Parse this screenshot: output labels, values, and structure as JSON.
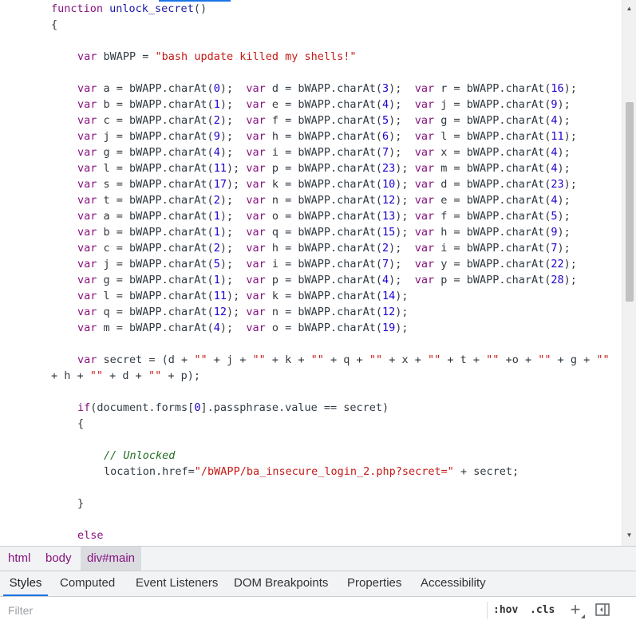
{
  "code_lines": [
    [
      [
        "kw",
        "function "
      ],
      [
        "fn",
        "unlock_secret"
      ],
      [
        "op",
        "()"
      ]
    ],
    [
      [
        "op",
        "{"
      ]
    ],
    [],
    [
      [
        "kw",
        "var "
      ],
      [
        "op",
        "bWAPP = "
      ],
      [
        "str",
        "\"bash update killed my shells!\""
      ]
    ],
    [],
    [
      [
        "kw",
        "var "
      ],
      [
        "op",
        "a = bWAPP.charAt("
      ],
      [
        "num",
        "0"
      ],
      [
        "op",
        ");  "
      ],
      [
        "kw",
        "var "
      ],
      [
        "op",
        "d = bWAPP.charAt("
      ],
      [
        "num",
        "3"
      ],
      [
        "op",
        ");  "
      ],
      [
        "kw",
        "var "
      ],
      [
        "op",
        "r = bWAPP.charAt("
      ],
      [
        "num",
        "16"
      ],
      [
        "op",
        ");"
      ]
    ],
    [
      [
        "kw",
        "var "
      ],
      [
        "op",
        "b = bWAPP.charAt("
      ],
      [
        "num",
        "1"
      ],
      [
        "op",
        ");  "
      ],
      [
        "kw",
        "var "
      ],
      [
        "op",
        "e = bWAPP.charAt("
      ],
      [
        "num",
        "4"
      ],
      [
        "op",
        ");  "
      ],
      [
        "kw",
        "var "
      ],
      [
        "op",
        "j = bWAPP.charAt("
      ],
      [
        "num",
        "9"
      ],
      [
        "op",
        ");"
      ]
    ],
    [
      [
        "kw",
        "var "
      ],
      [
        "op",
        "c = bWAPP.charAt("
      ],
      [
        "num",
        "2"
      ],
      [
        "op",
        ");  "
      ],
      [
        "kw",
        "var "
      ],
      [
        "op",
        "f = bWAPP.charAt("
      ],
      [
        "num",
        "5"
      ],
      [
        "op",
        ");  "
      ],
      [
        "kw",
        "var "
      ],
      [
        "op",
        "g = bWAPP.charAt("
      ],
      [
        "num",
        "4"
      ],
      [
        "op",
        ");"
      ]
    ],
    [
      [
        "kw",
        "var "
      ],
      [
        "op",
        "j = bWAPP.charAt("
      ],
      [
        "num",
        "9"
      ],
      [
        "op",
        ");  "
      ],
      [
        "kw",
        "var "
      ],
      [
        "op",
        "h = bWAPP.charAt("
      ],
      [
        "num",
        "6"
      ],
      [
        "op",
        ");  "
      ],
      [
        "kw",
        "var "
      ],
      [
        "op",
        "l = bWAPP.charAt("
      ],
      [
        "num",
        "11"
      ],
      [
        "op",
        ");"
      ]
    ],
    [
      [
        "kw",
        "var "
      ],
      [
        "op",
        "g = bWAPP.charAt("
      ],
      [
        "num",
        "4"
      ],
      [
        "op",
        ");  "
      ],
      [
        "kw",
        "var "
      ],
      [
        "op",
        "i = bWAPP.charAt("
      ],
      [
        "num",
        "7"
      ],
      [
        "op",
        ");  "
      ],
      [
        "kw",
        "var "
      ],
      [
        "op",
        "x = bWAPP.charAt("
      ],
      [
        "num",
        "4"
      ],
      [
        "op",
        ");"
      ]
    ],
    [
      [
        "kw",
        "var "
      ],
      [
        "op",
        "l = bWAPP.charAt("
      ],
      [
        "num",
        "11"
      ],
      [
        "op",
        "); "
      ],
      [
        "kw",
        "var "
      ],
      [
        "op",
        "p = bWAPP.charAt("
      ],
      [
        "num",
        "23"
      ],
      [
        "op",
        "); "
      ],
      [
        "kw",
        "var "
      ],
      [
        "op",
        "m = bWAPP.charAt("
      ],
      [
        "num",
        "4"
      ],
      [
        "op",
        ");"
      ]
    ],
    [
      [
        "kw",
        "var "
      ],
      [
        "op",
        "s = bWAPP.charAt("
      ],
      [
        "num",
        "17"
      ],
      [
        "op",
        "); "
      ],
      [
        "kw",
        "var "
      ],
      [
        "op",
        "k = bWAPP.charAt("
      ],
      [
        "num",
        "10"
      ],
      [
        "op",
        "); "
      ],
      [
        "kw",
        "var "
      ],
      [
        "op",
        "d = bWAPP.charAt("
      ],
      [
        "num",
        "23"
      ],
      [
        "op",
        ");"
      ]
    ],
    [
      [
        "kw",
        "var "
      ],
      [
        "op",
        "t = bWAPP.charAt("
      ],
      [
        "num",
        "2"
      ],
      [
        "op",
        ");  "
      ],
      [
        "kw",
        "var "
      ],
      [
        "op",
        "n = bWAPP.charAt("
      ],
      [
        "num",
        "12"
      ],
      [
        "op",
        "); "
      ],
      [
        "kw",
        "var "
      ],
      [
        "op",
        "e = bWAPP.charAt("
      ],
      [
        "num",
        "4"
      ],
      [
        "op",
        ");"
      ]
    ],
    [
      [
        "kw",
        "var "
      ],
      [
        "op",
        "a = bWAPP.charAt("
      ],
      [
        "num",
        "1"
      ],
      [
        "op",
        ");  "
      ],
      [
        "kw",
        "var "
      ],
      [
        "op",
        "o = bWAPP.charAt("
      ],
      [
        "num",
        "13"
      ],
      [
        "op",
        "); "
      ],
      [
        "kw",
        "var "
      ],
      [
        "op",
        "f = bWAPP.charAt("
      ],
      [
        "num",
        "5"
      ],
      [
        "op",
        ");"
      ]
    ],
    [
      [
        "kw",
        "var "
      ],
      [
        "op",
        "b = bWAPP.charAt("
      ],
      [
        "num",
        "1"
      ],
      [
        "op",
        ");  "
      ],
      [
        "kw",
        "var "
      ],
      [
        "op",
        "q = bWAPP.charAt("
      ],
      [
        "num",
        "15"
      ],
      [
        "op",
        "); "
      ],
      [
        "kw",
        "var "
      ],
      [
        "op",
        "h = bWAPP.charAt("
      ],
      [
        "num",
        "9"
      ],
      [
        "op",
        ");"
      ]
    ],
    [
      [
        "kw",
        "var "
      ],
      [
        "op",
        "c = bWAPP.charAt("
      ],
      [
        "num",
        "2"
      ],
      [
        "op",
        ");  "
      ],
      [
        "kw",
        "var "
      ],
      [
        "op",
        "h = bWAPP.charAt("
      ],
      [
        "num",
        "2"
      ],
      [
        "op",
        ");  "
      ],
      [
        "kw",
        "var "
      ],
      [
        "op",
        "i = bWAPP.charAt("
      ],
      [
        "num",
        "7"
      ],
      [
        "op",
        ");"
      ]
    ],
    [
      [
        "kw",
        "var "
      ],
      [
        "op",
        "j = bWAPP.charAt("
      ],
      [
        "num",
        "5"
      ],
      [
        "op",
        ");  "
      ],
      [
        "kw",
        "var "
      ],
      [
        "op",
        "i = bWAPP.charAt("
      ],
      [
        "num",
        "7"
      ],
      [
        "op",
        ");  "
      ],
      [
        "kw",
        "var "
      ],
      [
        "op",
        "y = bWAPP.charAt("
      ],
      [
        "num",
        "22"
      ],
      [
        "op",
        ");"
      ]
    ],
    [
      [
        "kw",
        "var "
      ],
      [
        "op",
        "g = bWAPP.charAt("
      ],
      [
        "num",
        "1"
      ],
      [
        "op",
        ");  "
      ],
      [
        "kw",
        "var "
      ],
      [
        "op",
        "p = bWAPP.charAt("
      ],
      [
        "num",
        "4"
      ],
      [
        "op",
        ");  "
      ],
      [
        "kw",
        "var "
      ],
      [
        "op",
        "p = bWAPP.charAt("
      ],
      [
        "num",
        "28"
      ],
      [
        "op",
        ");"
      ]
    ],
    [
      [
        "kw",
        "var "
      ],
      [
        "op",
        "l = bWAPP.charAt("
      ],
      [
        "num",
        "11"
      ],
      [
        "op",
        "); "
      ],
      [
        "kw",
        "var "
      ],
      [
        "op",
        "k = bWAPP.charAt("
      ],
      [
        "num",
        "14"
      ],
      [
        "op",
        ");"
      ]
    ],
    [
      [
        "kw",
        "var "
      ],
      [
        "op",
        "q = bWAPP.charAt("
      ],
      [
        "num",
        "12"
      ],
      [
        "op",
        "); "
      ],
      [
        "kw",
        "var "
      ],
      [
        "op",
        "n = bWAPP.charAt("
      ],
      [
        "num",
        "12"
      ],
      [
        "op",
        ");"
      ]
    ],
    [
      [
        "kw",
        "var "
      ],
      [
        "op",
        "m = bWAPP.charAt("
      ],
      [
        "num",
        "4"
      ],
      [
        "op",
        ");  "
      ],
      [
        "kw",
        "var "
      ],
      [
        "op",
        "o = bWAPP.charAt("
      ],
      [
        "num",
        "19"
      ],
      [
        "op",
        ");"
      ]
    ],
    [],
    [
      [
        "kw",
        "var "
      ],
      [
        "op",
        "secret = (d + "
      ],
      [
        "str",
        "\"\""
      ],
      [
        "op",
        " + j + "
      ],
      [
        "str",
        "\"\""
      ],
      [
        "op",
        " + k + "
      ],
      [
        "str",
        "\"\""
      ],
      [
        "op",
        " + q + "
      ],
      [
        "str",
        "\"\""
      ],
      [
        "op",
        " + x + "
      ],
      [
        "str",
        "\"\""
      ],
      [
        "op",
        " + t + "
      ],
      [
        "str",
        "\"\""
      ],
      [
        "op",
        " +o + "
      ],
      [
        "str",
        "\"\""
      ],
      [
        "op",
        " + g + "
      ],
      [
        "str",
        "\"\""
      ]
    ],
    [
      [
        "op",
        "+ h + "
      ],
      [
        "str",
        "\"\""
      ],
      [
        "op",
        " + d + "
      ],
      [
        "str",
        "\"\""
      ],
      [
        "op",
        " + p);"
      ]
    ],
    [],
    [
      [
        "kw",
        "if"
      ],
      [
        "op",
        "(document.forms["
      ],
      [
        "num",
        "0"
      ],
      [
        "op",
        "].passphrase.value == secret)"
      ]
    ],
    [
      [
        "op",
        "{"
      ]
    ],
    [],
    [
      [
        "com",
        "// Unlocked"
      ]
    ],
    [
      [
        "op",
        "location.href="
      ],
      [
        "str",
        "\"/bWAPP/ba_insecure_login_2.php?secret=\""
      ],
      [
        "op",
        " + secret;"
      ]
    ],
    [],
    [
      [
        "op",
        "}"
      ]
    ],
    [],
    [
      [
        "kw",
        "else"
      ]
    ]
  ],
  "line_indents": [
    64,
    64,
    0,
    97,
    0,
    97,
    97,
    97,
    97,
    97,
    97,
    97,
    97,
    97,
    97,
    97,
    97,
    97,
    97,
    97,
    97,
    0,
    97,
    64,
    0,
    97,
    97,
    0,
    130,
    130,
    0,
    97,
    0,
    97
  ],
  "breadcrumb": {
    "items": [
      "html",
      "body",
      "div#main"
    ]
  },
  "tabs": [
    "Styles",
    "Computed",
    "Event Listeners",
    "DOM Breakpoints",
    "Properties",
    "Accessibility"
  ],
  "filter": {
    "placeholder": "Filter",
    "hov_label": ":hov",
    "cls_label": ".cls",
    "plus_label": "+"
  },
  "scrollbar": {
    "up_arrow": "▲",
    "down_arrow": "▼"
  },
  "colors": {
    "keyword": "#881280",
    "string": "#c41a16",
    "number": "#1c00cf",
    "comment": "#236e25",
    "accent": "#1a73e8"
  }
}
